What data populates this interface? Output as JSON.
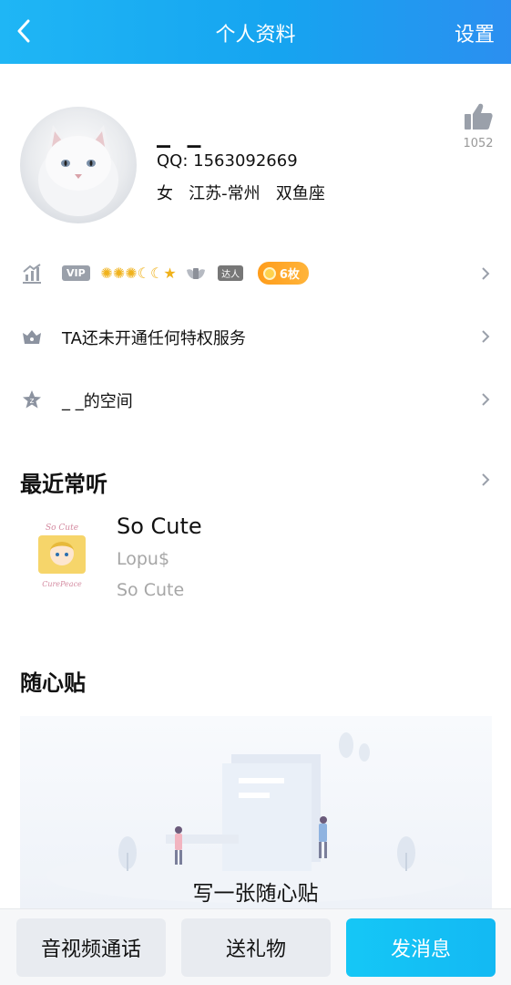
{
  "header": {
    "title": "个人资料",
    "settings_label": "设置"
  },
  "profile": {
    "nickname": "_ _",
    "qq_label": "QQ:",
    "qq_number": "1563092669",
    "gender": "女",
    "location": "江苏-常州",
    "zodiac": "双鱼座",
    "like_count": "1052"
  },
  "vip_row": {
    "vip_label": "VIP",
    "daren_label": "达人",
    "badge_count": "6枚"
  },
  "privilege_row": {
    "label": "TA还未开通任何特权服务"
  },
  "space_row": {
    "label": "_ _的空间"
  },
  "recent_music": {
    "section_title": "最近常听",
    "song": {
      "title": "So Cute",
      "artist": "Lopu$",
      "album": "So Cute"
    }
  },
  "note": {
    "section_title": "随心贴",
    "placeholder": "写一张随心贴"
  },
  "bottom_bar": {
    "call_label": "音视频通话",
    "gift_label": "送礼物",
    "message_label": "发消息"
  },
  "colors": {
    "header_gradient_start": "#1fb6f5",
    "header_gradient_end": "#2b8ff0",
    "primary_button": "#15c7f6",
    "badge_orange": "#ff9c1a"
  }
}
